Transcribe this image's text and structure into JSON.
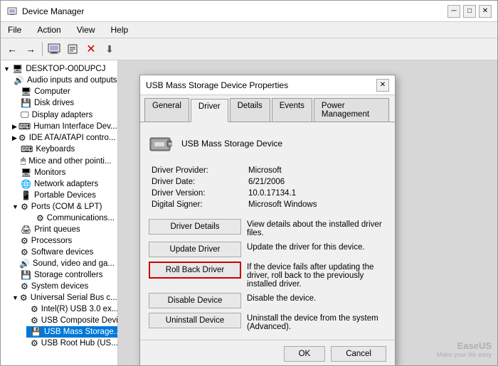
{
  "window": {
    "title": "Device Manager",
    "minimize": "─",
    "maximize": "□",
    "close": "✕"
  },
  "menu": {
    "items": [
      "File",
      "Action",
      "View",
      "Help"
    ]
  },
  "toolbar": {
    "buttons": [
      "←",
      "→",
      "🖥",
      "⚙",
      "❌",
      "⬇"
    ]
  },
  "tree": {
    "root": "DESKTOP-O0DUPCJ",
    "items": [
      {
        "label": "Audio inputs and outputs",
        "indent": 1,
        "icon": "🔊"
      },
      {
        "label": "Computer",
        "indent": 1,
        "icon": "🖥"
      },
      {
        "label": "Disk drives",
        "indent": 1,
        "icon": "💾"
      },
      {
        "label": "Display adapters",
        "indent": 1,
        "icon": "🖵"
      },
      {
        "label": "Human Interface Dev...",
        "indent": 1,
        "icon": "⌨"
      },
      {
        "label": "IDE ATA/ATAPI contro...",
        "indent": 1,
        "icon": "⚙"
      },
      {
        "label": "Keyboards",
        "indent": 1,
        "icon": "⌨"
      },
      {
        "label": "Mice and other pointi...",
        "indent": 1,
        "icon": "🖱"
      },
      {
        "label": "Monitors",
        "indent": 1,
        "icon": "🖥"
      },
      {
        "label": "Network adapters",
        "indent": 1,
        "icon": "🌐"
      },
      {
        "label": "Portable Devices",
        "indent": 1,
        "icon": "📱"
      },
      {
        "label": "Ports (COM & LPT)",
        "indent": 1,
        "icon": "⚙",
        "expanded": true
      },
      {
        "label": "Communications...",
        "indent": 2,
        "icon": "⚙"
      },
      {
        "label": "Print queues",
        "indent": 1,
        "icon": "🖨"
      },
      {
        "label": "Processors",
        "indent": 1,
        "icon": "⚙"
      },
      {
        "label": "Software devices",
        "indent": 1,
        "icon": "⚙"
      },
      {
        "label": "Sound, video and ga...",
        "indent": 1,
        "icon": "🔊"
      },
      {
        "label": "Storage controllers",
        "indent": 1,
        "icon": "💾"
      },
      {
        "label": "System devices",
        "indent": 1,
        "icon": "⚙"
      },
      {
        "label": "Universal Serial Bus c...",
        "indent": 1,
        "icon": "⚙",
        "expanded": true
      },
      {
        "label": "Intel(R) USB 3.0 ex...",
        "indent": 2,
        "icon": "⚙"
      },
      {
        "label": "USB Composite Devi...",
        "indent": 2,
        "icon": "⚙"
      },
      {
        "label": "USB Mass Storage...",
        "indent": 2,
        "icon": "💾",
        "selected": true
      },
      {
        "label": "USB Root Hub (US...",
        "indent": 2,
        "icon": "⚙"
      }
    ]
  },
  "dialog": {
    "title": "USB Mass Storage Device Properties",
    "tabs": [
      "General",
      "Driver",
      "Details",
      "Events",
      "Power Management"
    ],
    "active_tab": "Driver",
    "device_name": "USB Mass Storage Device",
    "driver_info": {
      "provider_label": "Driver Provider:",
      "provider_value": "Microsoft",
      "date_label": "Driver Date:",
      "date_value": "6/21/2006",
      "version_label": "Driver Version:",
      "version_value": "10.0.17134.1",
      "signer_label": "Digital Signer:",
      "signer_value": "Microsoft Windows"
    },
    "buttons": [
      {
        "label": "Driver Details",
        "description": "View details about the installed driver files."
      },
      {
        "label": "Update Driver",
        "description": "Update the driver for this device."
      },
      {
        "label": "Roll Back Driver",
        "description": "If the device fails after updating the driver, roll back to the previously installed driver.",
        "highlighted": true
      },
      {
        "label": "Disable Device",
        "description": "Disable the device."
      },
      {
        "label": "Uninstall Device",
        "description": "Uninstall the device from the system (Advanced)."
      }
    ],
    "footer": {
      "ok": "OK",
      "cancel": "Cancel"
    }
  },
  "watermark": {
    "brand": "EaseUS",
    "tagline": "Make your life easy"
  }
}
